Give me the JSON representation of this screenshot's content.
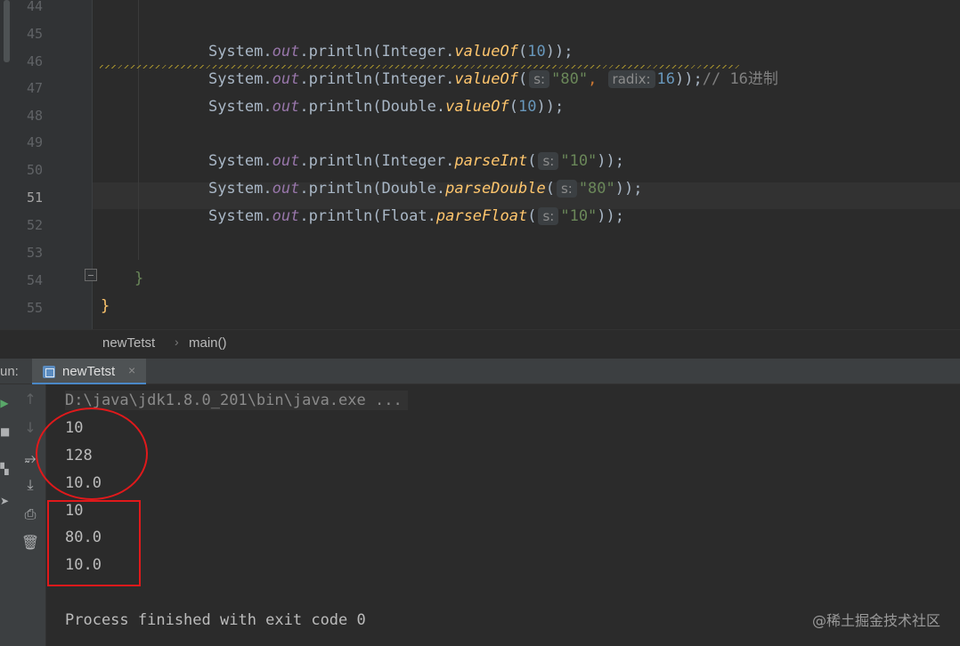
{
  "editor": {
    "line_numbers": [
      "44",
      "45",
      "46",
      "47",
      "48",
      "49",
      "50",
      "51",
      "52",
      "53",
      "54",
      "55"
    ],
    "lines": {
      "l45": {
        "a": "System.",
        "b": "out",
        "c": ".println(Integer.",
        "d": "valueOf",
        "e": "(",
        "f": "10",
        "g": "));"
      },
      "l46": {
        "a": "System.",
        "b": "out",
        "c": ".println(Integer.",
        "d": "valueOf",
        "e": "(",
        "hint_s": "s:",
        "f": "\"80\"",
        "g": ", ",
        "hint_radix": "radix:",
        "h": "16",
        "i": "));",
        "j": "// 16进制"
      },
      "l47": {
        "a": "System.",
        "b": "out",
        "c": ".println(Double.",
        "d": "valueOf",
        "e": "(",
        "f": "10",
        "g": "));"
      },
      "l49": {
        "a": "System.",
        "b": "out",
        "c": ".println(Integer.",
        "d": "parseInt",
        "e": "(",
        "hint_s": "s:",
        "f": "\"10\"",
        "g": "));"
      },
      "l50": {
        "a": "System.",
        "b": "out",
        "c": ".println(Double.",
        "d": "parseDouble",
        "e": "(",
        "hint_s": "s:",
        "f": "\"80\"",
        "g": "));"
      },
      "l51": {
        "a": "System.",
        "b": "out",
        "c": ".println(Float.",
        "d": "parseFloat",
        "e": "(",
        "hint_s": "s:",
        "f": "\"10\"",
        "g": "));"
      },
      "close_method": "}",
      "close_class": "}"
    }
  },
  "breadcrumb": {
    "items": [
      "newTetst",
      "main()"
    ],
    "separator": "›"
  },
  "run_panel": {
    "label": "un:",
    "tab_label": "newTetst",
    "tab_close": "×",
    "toolbar_icons": [
      "arrow-up-icon",
      "arrow-down-icon",
      "soft-wrap-icon",
      "scroll-to-end-icon",
      "print-icon",
      "trash-icon"
    ]
  },
  "console": {
    "command": "D:\\java\\jdk1.8.0_201\\bin\\java.exe ...",
    "output": [
      "10",
      "128",
      "10.0",
      "10",
      "80.0",
      "10.0"
    ],
    "exit_message": "Process finished with exit code 0"
  },
  "watermark": "@稀土掘金技术社区",
  "colors": {
    "annotation": "#e0191b",
    "keyword_field": "#9876aa",
    "method": "#ffc66d",
    "number": "#6897bb",
    "string": "#6a8759",
    "punct": "#cc7832"
  }
}
